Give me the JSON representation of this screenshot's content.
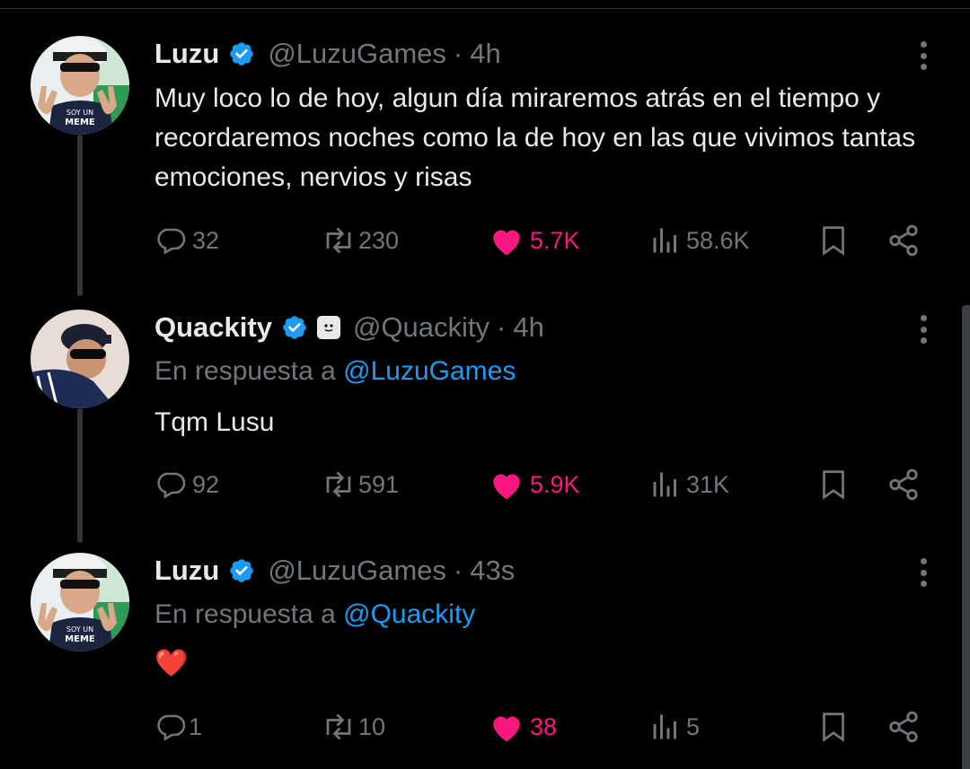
{
  "tweets": [
    {
      "name": "Luzu",
      "handle": "@LuzuGames",
      "sep": "·",
      "time": "4h",
      "reply_prefix": "",
      "reply_to": "",
      "text": "Muy loco lo de hoy, algun día miraremos atrás en el tiempo y recordaremos noches como la de hoy en las que vivimos tantas emociones, nervios y risas",
      "stats": {
        "replies": "32",
        "reposts": "230",
        "likes": "5.7K",
        "views": "58.6K"
      }
    },
    {
      "name": "Quackity",
      "handle": "@Quackity",
      "sep": "·",
      "time": "4h",
      "reply_prefix": "En respuesta a",
      "reply_to": "@LuzuGames",
      "text": "Tqm Lusu",
      "stats": {
        "replies": "92",
        "reposts": "591",
        "likes": "5.9K",
        "views": "31K"
      }
    },
    {
      "name": "Luzu",
      "handle": "@LuzuGames",
      "sep": "·",
      "time": "43s",
      "reply_prefix": "En respuesta a",
      "reply_to": "@Quackity",
      "text": "❤️",
      "stats": {
        "replies": "1",
        "reposts": "10",
        "likes": "38",
        "views": "5"
      }
    }
  ],
  "avatar_text": {
    "shirt_line1": "SOY UN",
    "shirt_line2": "MEME"
  },
  "colors": {
    "background": "#000000",
    "text": "#e7e9ea",
    "muted": "#71767b",
    "link": "#1d9bf0",
    "like": "#f91880",
    "verified": "#1d9bf0"
  },
  "icons": [
    "reply-icon",
    "repost-icon",
    "like-icon",
    "views-icon",
    "bookmark-icon",
    "share-icon",
    "verified-icon",
    "more-icon"
  ]
}
